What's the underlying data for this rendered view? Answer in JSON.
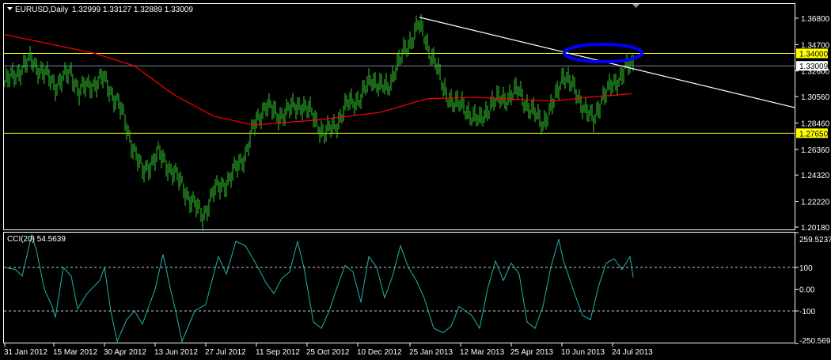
{
  "header": {
    "symbol_label": "EURUSD,Daily",
    "ohlc": "1.32999 1.33127 1.32889 1.33009"
  },
  "colors": {
    "background": "#000000",
    "bars": "#32cd32",
    "ma": "#ff0000",
    "trendline": "#ffffff",
    "hline": "#ffff00",
    "bid_line": "#778899",
    "cci": "#20b2aa",
    "ellipse": "#0000ff"
  },
  "chart_data": [
    {
      "type": "bar",
      "title": "EURUSD,Daily",
      "ylim": [
        1.2018,
        1.368
      ],
      "y_ticks": [
        "1.36800",
        "1.34700",
        "1.32600",
        "1.30560",
        "1.28460",
        "1.26360",
        "1.24320",
        "1.22220",
        "1.20180"
      ],
      "y_tick_values": [
        1.368,
        1.347,
        1.326,
        1.3056,
        1.2846,
        1.2636,
        1.2432,
        1.2222,
        1.2018
      ],
      "price_labels": [
        {
          "text": "1.34000",
          "value": 1.34,
          "kind": "hline"
        },
        {
          "text": "1.33009",
          "value": 1.33009,
          "kind": "bid"
        },
        {
          "text": "1.27650",
          "value": 1.2765,
          "kind": "hline"
        }
      ],
      "trendline": {
        "from": {
          "bar": 262,
          "price": 1.3687
        },
        "to": {
          "bar": 500,
          "price": 1.2969
        }
      },
      "highlight_ellipse": {
        "bar": 378,
        "price": 1.3403
      },
      "close_keypoints": {
        "bar": [
          0,
          17,
          20,
          32,
          42,
          47,
          62,
          72,
          80,
          87,
          97,
          107,
          117,
          125,
          132,
          142,
          152,
          157,
          165,
          172,
          180,
          187,
          195,
          202,
          210,
          217,
          225,
          232,
          242,
          247,
          255,
          261,
          267,
          272,
          277,
          285,
          292,
          300,
          307,
          317,
          325,
          332,
          340,
          347,
          353,
          360,
          365,
          372,
          377,
          385,
          392,
          397
        ],
        "close": [
          1.316,
          1.335,
          1.33,
          1.315,
          1.325,
          1.31,
          1.32,
          1.3,
          1.27,
          1.245,
          1.26,
          1.245,
          1.225,
          1.21,
          1.23,
          1.24,
          1.26,
          1.28,
          1.3,
          1.29,
          1.295,
          1.3,
          1.29,
          1.275,
          1.285,
          1.3,
          1.305,
          1.32,
          1.31,
          1.33,
          1.345,
          1.365,
          1.345,
          1.335,
          1.31,
          1.3,
          1.295,
          1.285,
          1.3,
          1.305,
          1.31,
          1.295,
          1.285,
          1.3,
          1.325,
          1.31,
          1.3,
          1.285,
          1.305,
          1.315,
          1.328,
          1.33009
        ]
      },
      "ma_keypoints": {
        "bar": [
          0,
          57,
          82,
          107,
          132,
          157,
          197,
          237,
          267,
          297,
          347,
          367,
          397
        ],
        "value": [
          1.355,
          1.34,
          1.33,
          1.307,
          1.29,
          1.283,
          1.287,
          1.293,
          1.304,
          1.305,
          1.302,
          1.305,
          1.308
        ]
      },
      "x_ticks": [
        "31 Jan 2012",
        "15 Mar 2012",
        "30 Apr 2012",
        "13 Jun 2012",
        "27 Jul 2012",
        "11 Sep 2012",
        "25 Oct 2012",
        "10 Dec 2012",
        "25 Jan 2013",
        "12 Mar 2013",
        "25 Apr 2013",
        "10 Jun 2013",
        "24 Jul 2013"
      ],
      "x_tick_bars": [
        0,
        31,
        63,
        95,
        127,
        159,
        191,
        223,
        256,
        288,
        320,
        352,
        384
      ]
    },
    {
      "type": "line",
      "title": "CCI(20) 54.5639",
      "ylim": [
        -250.569,
        259.5237
      ],
      "y_ticks": [
        "259.5237",
        "100",
        "0.00",
        "-100",
        "-250.569"
      ],
      "y_tick_values": [
        259.5237,
        100,
        0,
        -100,
        -250.569
      ],
      "levels": [
        100,
        -100
      ],
      "series": [
        {
          "name": "CCI(20)",
          "bar": [
            0,
            7,
            11,
            17,
            20,
            25,
            30,
            32,
            37,
            42,
            46,
            52,
            60,
            63,
            67,
            71,
            77,
            82,
            87,
            95,
            100,
            105,
            108,
            112,
            120,
            127,
            132,
            135,
            140,
            146,
            152,
            160,
            165,
            170,
            175,
            180,
            185,
            189,
            195,
            200,
            205,
            210,
            215,
            220,
            225,
            230,
            235,
            240,
            245,
            250,
            255,
            260,
            265,
            271,
            277,
            282,
            287,
            295,
            300,
            305,
            310,
            315,
            320,
            325,
            330,
            335,
            340,
            345,
            350,
            353,
            360,
            365,
            370,
            375,
            380,
            385,
            390,
            395,
            397
          ],
          "value": [
            100,
            90,
            60,
            250,
            180,
            0,
            -80,
            -130,
            100,
            60,
            -90,
            -20,
            40,
            100,
            -100,
            -240,
            -140,
            -100,
            -160,
            0,
            160,
            -10,
            -100,
            -240,
            -100,
            -70,
            70,
            150,
            70,
            220,
            200,
            100,
            30,
            -20,
            50,
            80,
            220,
            100,
            -150,
            -180,
            -100,
            10,
            110,
            80,
            -60,
            150,
            100,
            -40,
            60,
            200,
            100,
            40,
            -40,
            -180,
            -200,
            -170,
            -80,
            -120,
            -180,
            0,
            130,
            40,
            120,
            70,
            -150,
            -180,
            -80,
            100,
            230,
            130,
            -20,
            -120,
            -140,
            10,
            120,
            140,
            90,
            150,
            55
          ]
        }
      ]
    }
  ]
}
